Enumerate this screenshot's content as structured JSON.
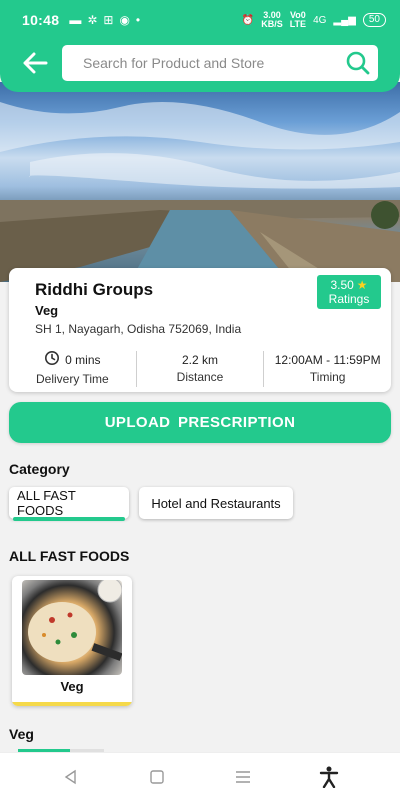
{
  "status_bar": {
    "time": "10:48",
    "net_speed_top": "3.00",
    "net_speed_bottom": "KB/S",
    "volte_top": "Vo0",
    "volte_bottom": "LTE",
    "network": "4G",
    "battery": "50"
  },
  "header": {
    "search_placeholder": "Search for Product and Store"
  },
  "store": {
    "name": "Riddhi Groups",
    "type": "Veg",
    "address": "SH 1, Nayagarh, Odisha 752069, India",
    "rating_value": "3.50",
    "rating_label": "Ratings",
    "delivery_time_value": "0 mins",
    "delivery_time_label": "Delivery Time",
    "distance_value": "2.2 km",
    "distance_label": "Distance",
    "timing_value": "12:00AM - 11:59PM",
    "timing_label": "Timing"
  },
  "upload_button": "UPLOAD  PRESCRIPTION",
  "category": {
    "heading": "Category",
    "items": [
      {
        "label": "ALL FAST FOODS",
        "active": true
      },
      {
        "label": "Hotel and Restaurants",
        "active": false
      }
    ]
  },
  "section": {
    "heading": "ALL FAST FOODS",
    "products": [
      {
        "label": "Veg"
      }
    ]
  },
  "next_section": {
    "heading": "Veg"
  },
  "colors": {
    "accent": "#23c98d",
    "star": "#ffd21f",
    "highlight": "#f5d94a"
  }
}
